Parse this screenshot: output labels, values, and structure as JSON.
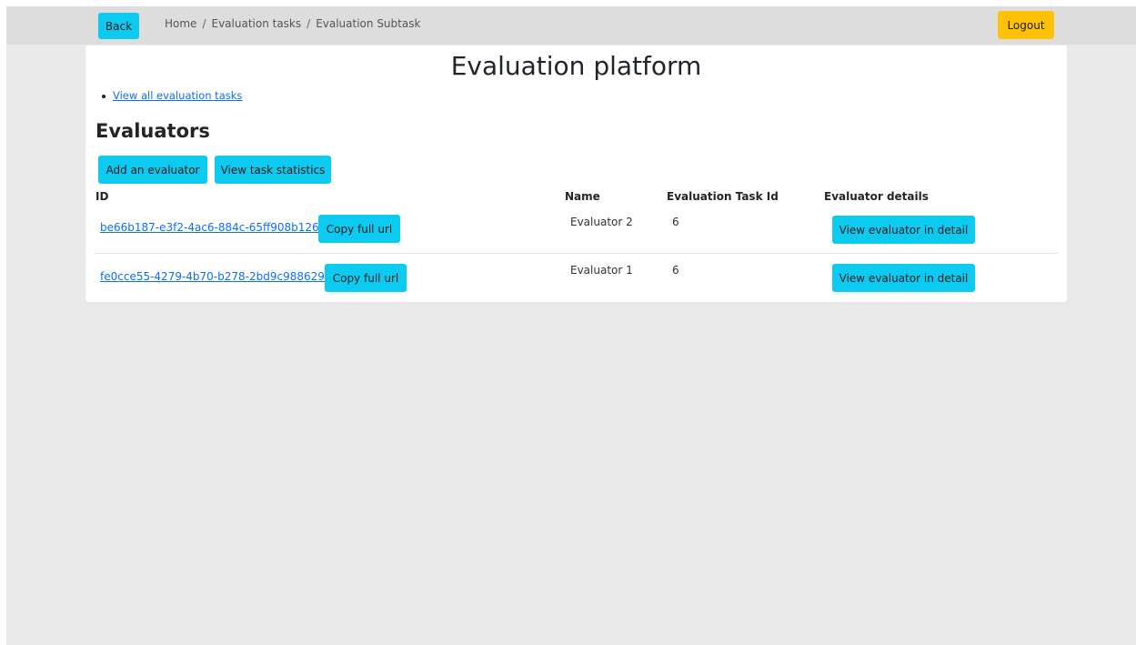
{
  "nav": {
    "back_label": "Back",
    "breadcrumbs": [
      "Home",
      "Evaluation tasks",
      "Evaluation Subtask"
    ],
    "breadcrumb_separator": "/",
    "logout_label": "Logout"
  },
  "page": {
    "title": "Evaluation platform",
    "links": [
      "View all evaluation tasks"
    ],
    "section_title": "Evaluators",
    "actions": {
      "add_label": "Add an evaluator",
      "stats_label": "View task statistics"
    }
  },
  "table": {
    "headers": [
      "ID",
      "Name",
      "Evaluation Task Id",
      "Evaluator details"
    ],
    "rows": [
      {
        "id": "be66b187-e3f2-4ac6-884c-65ff908b126c",
        "copy_label": "Copy full url",
        "name": "Evaluator 2",
        "task_id": "6",
        "detail_label": "View evaluator in detail"
      },
      {
        "id": "fe0cce55-4279-4b70-b278-2bd9c988629a",
        "copy_label": "Copy full url",
        "name": "Evaluator 1",
        "task_id": "6",
        "detail_label": "View evaluator in detail"
      }
    ]
  },
  "colors": {
    "info_button": "#0dcaf0",
    "warning_button": "#ffc107",
    "link": "#0d6efd",
    "topbar": "#dddddd",
    "background": "#e9e9e9"
  }
}
